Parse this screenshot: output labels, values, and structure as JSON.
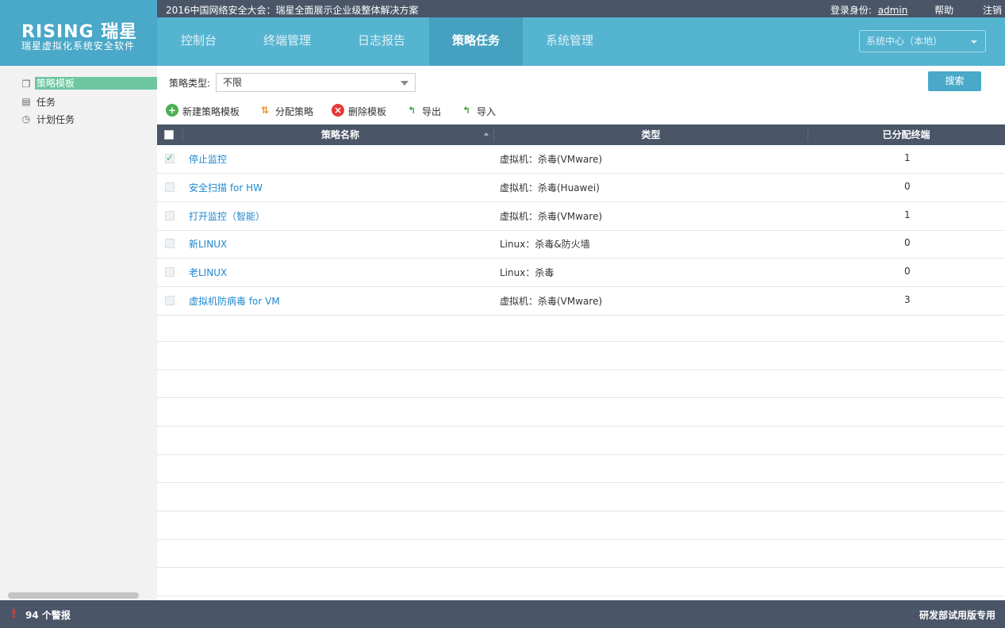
{
  "topbar": {
    "notice": "2016中国网络安全大会：瑞星全面展示企业级整体解决方案",
    "login_label": "登录身份:",
    "user": "admin",
    "help": "帮助",
    "logout": "注销"
  },
  "brand": {
    "logo": "RISING 瑞星",
    "subtitle": "瑞星虚拟化系统安全软件"
  },
  "nav": {
    "items": [
      {
        "label": "控制台"
      },
      {
        "label": "终端管理"
      },
      {
        "label": "日志报告"
      },
      {
        "label": "策略任务",
        "active": true
      },
      {
        "label": "系统管理"
      }
    ],
    "site_select": "系统中心（本地）"
  },
  "sidebar": {
    "items": [
      {
        "label": "策略模板",
        "icon": "template-icon",
        "active": true
      },
      {
        "label": "任务",
        "icon": "clipboard-icon"
      },
      {
        "label": "计划任务",
        "icon": "clock-icon"
      }
    ]
  },
  "filter": {
    "label": "策略类型:",
    "value": "不限",
    "search_label": "搜索"
  },
  "actions": {
    "new": "新建策略模板",
    "assign": "分配策略",
    "delete": "删除模板",
    "export": "导出",
    "import": "导入"
  },
  "table": {
    "columns": [
      "策略名称",
      "类型",
      "已分配终端"
    ],
    "rows": [
      {
        "name": "停止监控",
        "type": "虚拟机：杀毒(VMware)",
        "count": "1",
        "checked": true
      },
      {
        "name": "安全扫描 for HW",
        "type": "虚拟机：杀毒(Huawei)",
        "count": "0",
        "checked": false
      },
      {
        "name": "打开监控（智能）",
        "type": "虚拟机：杀毒(VMware)",
        "count": "1",
        "checked": false
      },
      {
        "name": "新LINUX",
        "type": "Linux：杀毒&防火墙",
        "count": "0",
        "checked": false
      },
      {
        "name": "老LINUX",
        "type": "Linux：杀毒",
        "count": "0",
        "checked": false
      },
      {
        "name": "虚拟机防病毒 for VM",
        "type": "虚拟机：杀毒(VMware)",
        "count": "3",
        "checked": false
      }
    ]
  },
  "footer": {
    "alerts": "94 个警报",
    "edition": "研发部试用版专用"
  },
  "colors": {
    "header": "#55b4d0",
    "dark_bar": "#4a5668",
    "link": "#1e88d0",
    "active_side": "#6dc6a0"
  }
}
